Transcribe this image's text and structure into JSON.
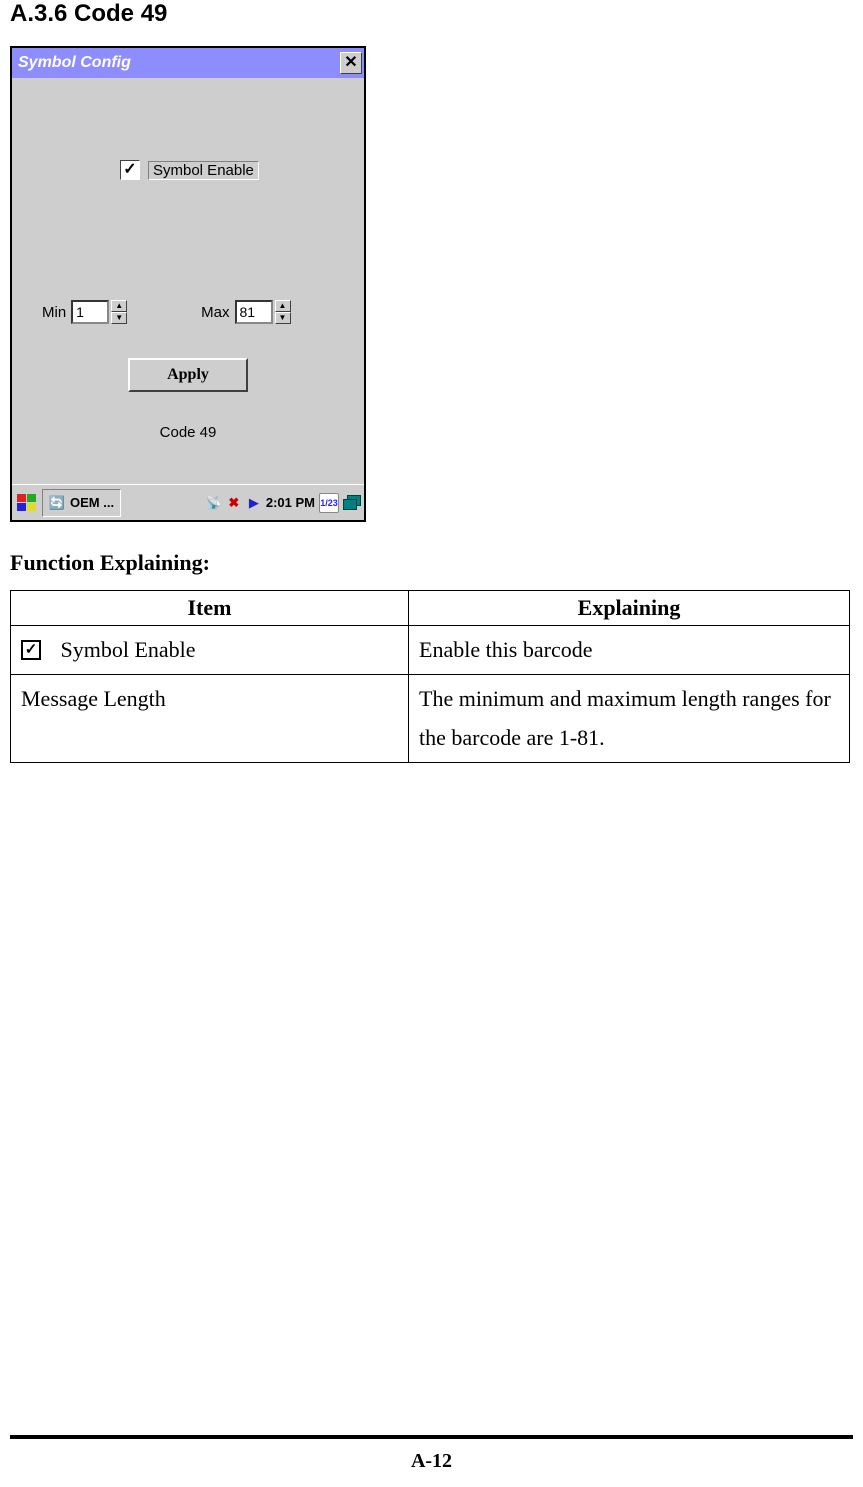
{
  "section_title": "A.3.6 Code 49",
  "window": {
    "title": "Symbol Config",
    "checkbox_label": "Symbol Enable",
    "checkbox_checked": true,
    "min_label": "Min",
    "min_value": "1",
    "max_label": "Max",
    "max_value": "81",
    "apply_label": "Apply",
    "code_label": "Code 49"
  },
  "taskbar": {
    "task_label": "OEM ...",
    "clock": "2:01 PM",
    "keyboard_badge": "1/23"
  },
  "func": {
    "heading": "Function Explaining:",
    "header_item": "Item",
    "header_explain": "Explaining",
    "rows": [
      {
        "has_checkbox": true,
        "checkbox_mark": "✓",
        "item": "Symbol Enable",
        "explain": "Enable this barcode"
      },
      {
        "has_checkbox": false,
        "item": "Message Length",
        "explain": "The minimum and maximum length ranges for the barcode are 1-81."
      }
    ]
  },
  "page_number": "A-12"
}
